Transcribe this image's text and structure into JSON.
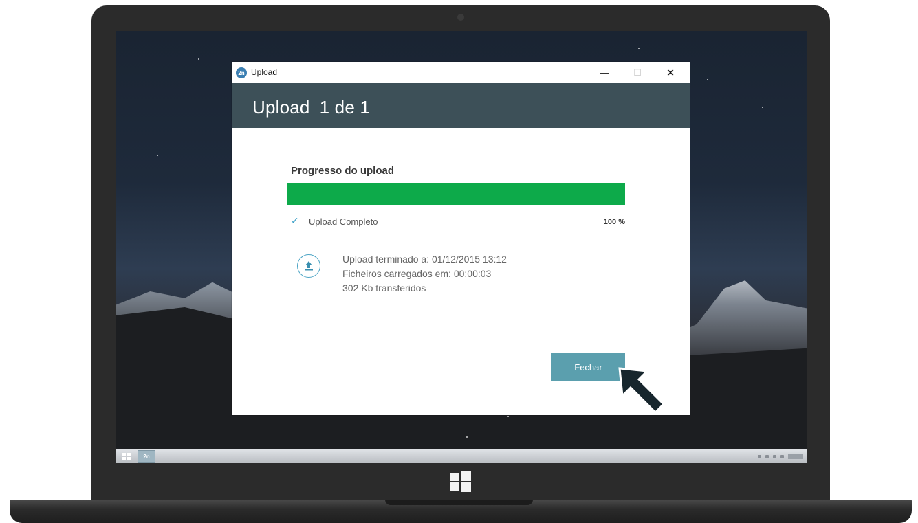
{
  "window": {
    "title": "Upload",
    "logo_text": "2n",
    "minimize_glyph": "—",
    "maximize_glyph": "☐",
    "close_glyph": "✕"
  },
  "header": {
    "title": "Upload",
    "count": "1 de 1"
  },
  "progress": {
    "section_title": "Progresso do upload",
    "value": 100,
    "status_label": "Upload Completo",
    "percent_label": "100 %",
    "fill_color": "#0daa4a"
  },
  "details": {
    "finished_at": "Upload terminado a: 01/12/2015 13:12",
    "duration": "Ficheiros carregados em: 00:00:03",
    "transferred": "302 Kb transferidos"
  },
  "actions": {
    "close_label": "Fechar"
  },
  "taskbar": {
    "app_label": "2n"
  },
  "colors": {
    "header_band": "#3d5058",
    "accent": "#5b9fae",
    "check": "#3a9fc7"
  },
  "icons": {
    "check": "check-icon",
    "upload": "upload-circle-icon",
    "cursor": "pointer-arrow-icon"
  }
}
